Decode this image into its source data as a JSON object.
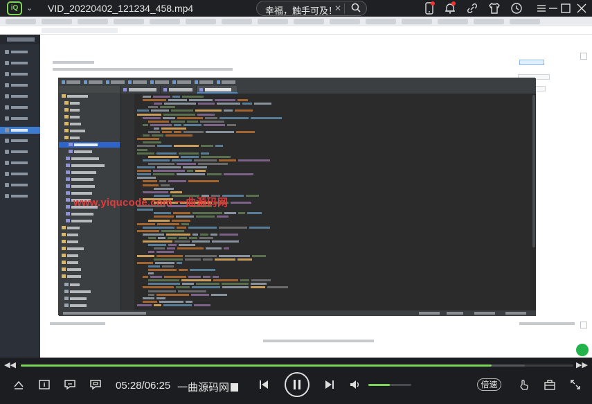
{
  "app": {
    "logo_text": "iQ",
    "title": "VID_20220402_121234_458.mp4",
    "search_text": "幸福，触手可及！"
  },
  "watermark": "www.yiqucode.com 一曲源码网",
  "player": {
    "current_time": "05:28",
    "time_separator": "/",
    "total_time": "06:25",
    "subtitle": "一曲源码网",
    "speed_label": "倍速",
    "progress_fraction": 0.852,
    "volume_fraction": 0.5,
    "accent_color": "#7ed35b"
  },
  "icons": {
    "titlebar": [
      "phone-icon",
      "bell-icon",
      "link-icon",
      "shirt-icon",
      "clock-icon",
      "menu-icon",
      "minimize-icon",
      "maximize-icon",
      "close-icon"
    ],
    "controls": [
      "mini-mode-icon",
      "subtitle-icon",
      "danmaku-icon",
      "screenshot-icon",
      "previous-icon",
      "pause-icon",
      "next-icon",
      "volume-icon",
      "gesture-icon",
      "toolbox-icon",
      "fullscreen-icon"
    ]
  }
}
